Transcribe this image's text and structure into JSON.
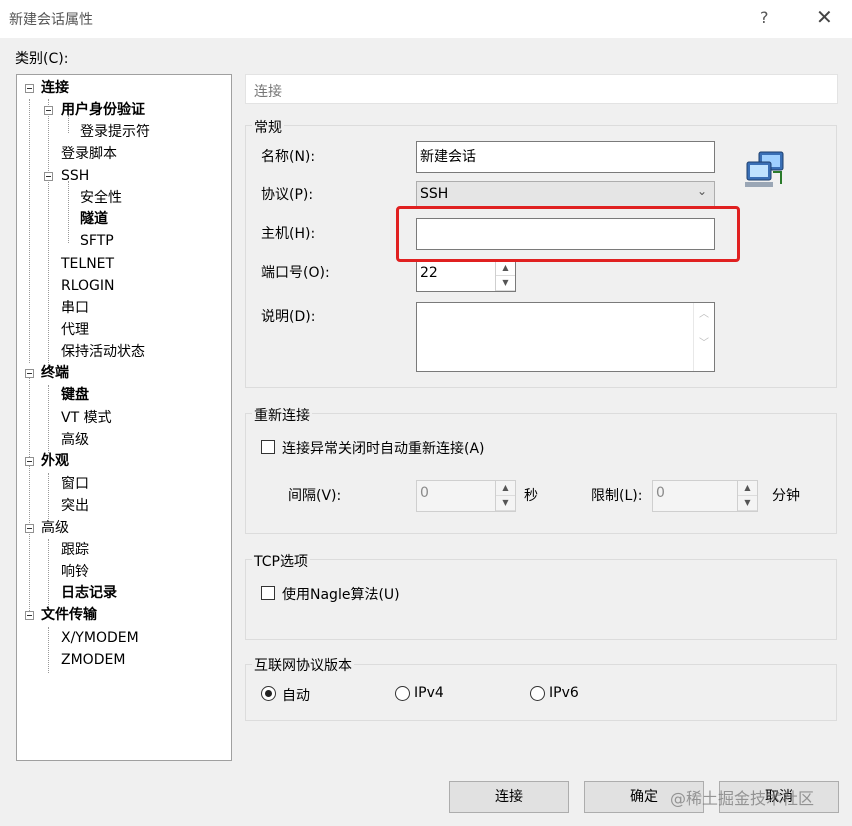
{
  "window": {
    "title": "新建会话属性",
    "help": "?",
    "close": "✕"
  },
  "category_label": "类别(C):",
  "tree": [
    {
      "label": "连接",
      "bold": true
    },
    {
      "label": "用户身份验证",
      "bold": true
    },
    {
      "label": "登录提示符",
      "bold": false
    },
    {
      "label": "登录脚本",
      "bold": false
    },
    {
      "label": "SSH",
      "bold": false
    },
    {
      "label": "安全性",
      "bold": false
    },
    {
      "label": "隧道",
      "bold": true
    },
    {
      "label": "SFTP",
      "bold": false
    },
    {
      "label": "TELNET",
      "bold": false
    },
    {
      "label": "RLOGIN",
      "bold": false
    },
    {
      "label": "串口",
      "bold": false
    },
    {
      "label": "代理",
      "bold": false
    },
    {
      "label": "保持活动状态",
      "bold": false
    },
    {
      "label": "终端",
      "bold": true
    },
    {
      "label": "键盘",
      "bold": true
    },
    {
      "label": "VT 模式",
      "bold": false
    },
    {
      "label": "高级",
      "bold": false
    },
    {
      "label": "外观",
      "bold": true
    },
    {
      "label": "窗口",
      "bold": false
    },
    {
      "label": "突出",
      "bold": false
    },
    {
      "label": "高级",
      "bold": false
    },
    {
      "label": "跟踪",
      "bold": false
    },
    {
      "label": "响铃",
      "bold": false
    },
    {
      "label": "日志记录",
      "bold": true
    },
    {
      "label": "文件传输",
      "bold": true
    },
    {
      "label": "X/YMODEM",
      "bold": false
    },
    {
      "label": "ZMODEM",
      "bold": false
    }
  ],
  "section_header": "连接",
  "general": {
    "title": "常规",
    "name_label": "名称(N):",
    "name_value": "新建会话",
    "protocol_label": "协议(P):",
    "protocol_value": "SSH",
    "host_label": "主机(H):",
    "host_value": "",
    "port_label": "端口号(O):",
    "port_value": "22",
    "desc_label": "说明(D):",
    "desc_value": "",
    "icon": "network-computers-icon"
  },
  "reconnect": {
    "title": "重新连接",
    "checkbox_label": "连接异常关闭时自动重新连接(A)",
    "checked": false,
    "interval_label": "间隔(V):",
    "interval_value": "0",
    "interval_unit": "秒",
    "limit_label": "限制(L):",
    "limit_value": "0",
    "limit_unit": "分钟"
  },
  "tcp": {
    "title": "TCP选项",
    "nagle_label": "使用Nagle算法(U)",
    "checked": false
  },
  "ipver": {
    "title": "互联网协议版本",
    "options": [
      "自动",
      "IPv4",
      "IPv6"
    ],
    "selected": "自动"
  },
  "buttons": {
    "connect": "连接",
    "ok": "确定",
    "cancel": "取消"
  },
  "watermark": "@稀土掘金技术社区",
  "colors": {
    "highlight": "#e02020",
    "window_bg": "#f0f0f0"
  }
}
